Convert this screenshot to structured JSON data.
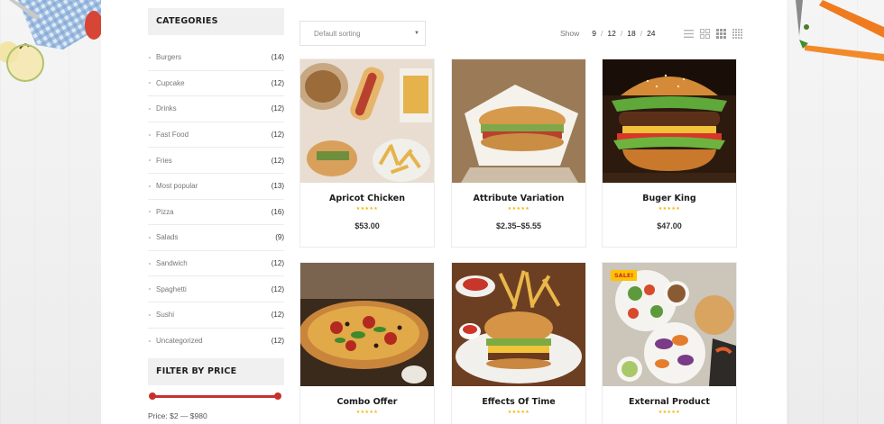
{
  "sidebar": {
    "categories_title": "CATEGORIES",
    "categories": [
      {
        "name": "Burgers",
        "count": "(14)"
      },
      {
        "name": "Cupcake",
        "count": "(12)"
      },
      {
        "name": "Drinks",
        "count": "(12)"
      },
      {
        "name": "Fast Food",
        "count": "(12)"
      },
      {
        "name": "Fries",
        "count": "(12)"
      },
      {
        "name": "Most popular",
        "count": "(13)"
      },
      {
        "name": "Pizza",
        "count": "(16)"
      },
      {
        "name": "Salads",
        "count": "(9)"
      },
      {
        "name": "Sandwich",
        "count": "(12)"
      },
      {
        "name": "Spaghetti",
        "count": "(12)"
      },
      {
        "name": "Sushi",
        "count": "(12)"
      },
      {
        "name": "Uncategorized",
        "count": "(12)"
      }
    ],
    "price_filter_title": "FILTER BY PRICE",
    "price_text": "Price: $2 — $980",
    "slider": {
      "min_fraction": 0.0,
      "max_fraction": 1.0
    },
    "accent_color": "#c8312b"
  },
  "toolbar": {
    "sort_value": "Default sorting",
    "show_label": "Show",
    "show_options": [
      "9",
      "12",
      "18",
      "24"
    ],
    "view_icons": [
      "list-view-icon",
      "grid-2-icon",
      "grid-3-icon",
      "grid-4-icon"
    ]
  },
  "products": [
    {
      "title": "Apricot Chicken",
      "price": "$53.00",
      "image": "hotdogs-fries-photo",
      "rating_stars": "★★★★★"
    },
    {
      "title": "Attribute Variation",
      "price": "$2.35–$5.55",
      "image": "sandwich-photo",
      "rating_stars": "★★★★★"
    },
    {
      "title": "Buger King",
      "price": "$47.00",
      "image": "burger-photo",
      "rating_stars": "★★★★★"
    },
    {
      "title": "Combo Offer",
      "price": "",
      "image": "pizza-photo",
      "rating_stars": "★★★★★"
    },
    {
      "title": "Effects Of Time",
      "price": "",
      "image": "burger-fries-photo",
      "rating_stars": "★★★★★"
    },
    {
      "title": "External Product",
      "price": "",
      "image": "salad-bowls-photo",
      "rating_stars": "★★★★★",
      "badge": "SALE!"
    }
  ]
}
